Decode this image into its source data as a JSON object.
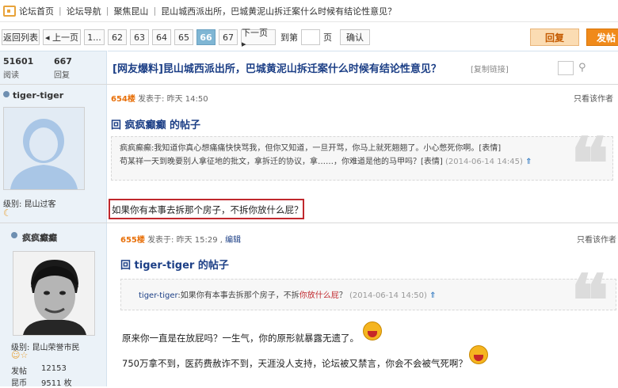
{
  "breadcrumb": [
    "论坛首页",
    "论坛导航",
    "聚焦昆山",
    "昆山城西派出所，巴城黄泥山拆迁案什么时候有结论性意见？"
  ],
  "pager": {
    "back": "返回列表",
    "prev": "◂ 上一页",
    "pages": [
      "1...",
      "62",
      "63",
      "64",
      "65",
      "66",
      "67"
    ],
    "current": "66",
    "next": "下一页 ▸",
    "goto_label": "到第",
    "page_unit": "页",
    "confirm": "确认",
    "reply": "回复",
    "post": "发帖"
  },
  "thread": {
    "views": "51601",
    "views_label": "阅读",
    "replies": "667",
    "replies_label": "回复",
    "title": "[网友爆料]昆山城西派出所，巴城黄泥山拆迁案什么时候有结论性意见？",
    "copy_link": "[复制链接]"
  },
  "posts": [
    {
      "author": "tiger-tiger",
      "level_label": "级别: 昆山过客",
      "floor": "654楼",
      "posted": "发表于: 昨天 14:50",
      "only_author": "只看该作者",
      "reply_to": "回 疯疯癫癫 的帖子",
      "quote_line1": "疯疯癫癫:我知道你真心想痛痛快快骂我，但你又知道，一旦开骂，你马上就死翘翘了。小心憋死你啊。[表情]",
      "quote_line2": "苟某祥一天到晚要别人拿征地的批文，拿拆迁的协议，拿……，你难道是他的马甲吗？[表情]",
      "quote_time": "(2014-06-14 14:45)",
      "body": "如果你有本事去拆那个房子，不拆你放什么屁？"
    },
    {
      "author": "疯疯癫癫",
      "level_label": "级别: 昆山荣誉市民",
      "floor": "655楼",
      "posted": "发表于: 昨天 15:29 ,",
      "edit": "编辑",
      "only_author": "只看该作者",
      "reply_to": "回 tiger-tiger 的帖子",
      "quote_user": "tiger-tiger",
      "quote_text": ":如果你有本事去拆那个房子，不拆",
      "quote_red": "你放什么屁",
      "quote_tail": "？",
      "quote_time": "(2014-06-14 14:50)",
      "body_line1": "原来你一直是在放屁吗？一生气，你的原形就暴露无遗了。",
      "body_line2": "750万拿不到，医药费赦诈不到，天涯没人支持，论坛被又禁言，你会不会被气死啊？",
      "stats": [
        {
          "label": "发帖",
          "value": "12153"
        },
        {
          "label": "昆币",
          "value": "9511 枚"
        }
      ]
    }
  ],
  "colors": {
    "accent": "#1c3f86",
    "floor": "#e8700a",
    "highlight_border": "#c0282d",
    "current_page": "#7fb6d4"
  }
}
